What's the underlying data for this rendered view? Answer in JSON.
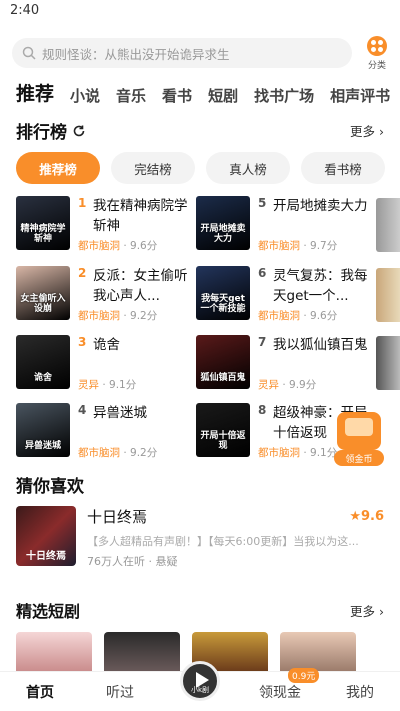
{
  "status": {
    "time": "2:40"
  },
  "search": {
    "placeholder": "规则怪谈：从熊出没开始诡异求生"
  },
  "category": {
    "label": "分类"
  },
  "tabs": [
    "推荐",
    "小说",
    "音乐",
    "看书",
    "短剧",
    "找书广场",
    "相声评书"
  ],
  "ranking": {
    "title": "排行榜",
    "more": "更多",
    "chips": [
      "推荐榜",
      "完结榜",
      "真人榜",
      "看书榜"
    ],
    "items": [
      {
        "num": "1",
        "title": "我在精神病院学斩神",
        "genre": "都市脑洞",
        "score": "9.6分",
        "cover_text": "精神病院学斩神",
        "cover_color": "#2a3140"
      },
      {
        "num": "2",
        "title": "反派：女主偷听我心声人...",
        "genre": "都市脑洞",
        "score": "9.2分",
        "cover_text": "女主偷听入设崩",
        "cover_color": "#d9b7a7"
      },
      {
        "num": "3",
        "title": "诡舍",
        "genre": "灵异",
        "score": "9.1分",
        "cover_text": "诡舍",
        "cover_color": "#2b2b2b"
      },
      {
        "num": "4",
        "title": "异兽迷城",
        "genre": "都市脑洞",
        "score": "9.2分",
        "cover_text": "异兽迷城",
        "cover_color": "#4a5560"
      },
      {
        "num": "5",
        "title": "开局地摊卖大力",
        "genre": "都市脑洞",
        "score": "9.7分",
        "cover_text": "开局地摊卖大力",
        "cover_color": "#1c2c4a"
      },
      {
        "num": "6",
        "title": "灵气复苏：我每天get一个...",
        "genre": "都市脑洞",
        "score": "9.6分",
        "cover_text": "我每天get一个新技能",
        "cover_color": "#23355c"
      },
      {
        "num": "7",
        "title": "我以狐仙镇百鬼",
        "genre": "灵异",
        "score": "9.9分",
        "cover_text": "狐仙镇百鬼",
        "cover_color": "#5a1a1a"
      },
      {
        "num": "8",
        "title": "超级神豪：开局十倍返现",
        "genre": "都市脑洞",
        "score": "9.1分",
        "cover_text": "开局十倍返现",
        "cover_color": "#1a1a1a"
      }
    ]
  },
  "reward": {
    "label": "领金币"
  },
  "guess": {
    "title": "猜你喜欢",
    "book": {
      "title": "十日终焉",
      "score": "9.6",
      "desc": "【多人超精品有声剧！】【每天6:00更新】当我以为这...",
      "meta": "76万人在听 · 悬疑",
      "cover_text": "十日终焉"
    }
  },
  "shorts": {
    "title": "精选短剧",
    "more": "更多"
  },
  "nav": {
    "home": "首页",
    "listened": "听过",
    "player": "小k剧",
    "coins": "领现金",
    "coins_badge": "0.9元",
    "mine": "我的"
  },
  "colors": {
    "accent": "#f98e2a"
  }
}
